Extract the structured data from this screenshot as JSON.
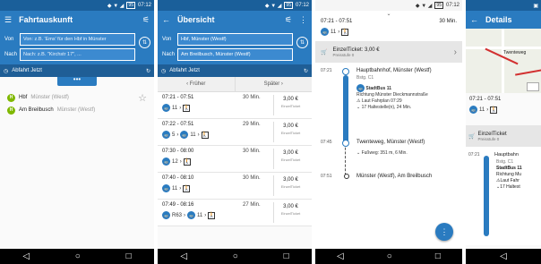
{
  "status": {
    "time": "07:12",
    "battery": "95"
  },
  "search": {
    "title": "Fahrtauskunft",
    "from_label": "Von",
    "from_placeholder": "Von: z.B. 'Ems' für den Hbf in Münster",
    "to_label": "Nach",
    "to_placeholder": "Nach: z.B. \"Kirchstr 17\", ...",
    "departure": "Abfahrt Jetzt",
    "more": "•••",
    "favorites": [
      {
        "name": "Hbf",
        "sub": "Münster (Westf)"
      },
      {
        "name": "Am Breilbusch",
        "sub": "Münster (Westf)"
      }
    ]
  },
  "overview": {
    "title": "Übersicht",
    "from_label": "Von",
    "from_value": "Hbf, Münster (Westf)",
    "to_label": "Nach",
    "to_value": "Am Breilbusch, Münster (Westf)",
    "departure": "Abfahrt Jetzt",
    "earlier": "Früher",
    "later": "Später",
    "ticket_label": "EinzelTicket",
    "connections": [
      {
        "time": "07:21 - 07:51",
        "dur": "30 Min.",
        "price": "3,00 €",
        "legs": [
          "11",
          "walk"
        ]
      },
      {
        "time": "07:22 - 07:51",
        "dur": "29 Min.",
        "price": "3,00 €",
        "legs": [
          "5",
          "11",
          "walk"
        ]
      },
      {
        "time": "07:30 - 08:00",
        "dur": "30 Min.",
        "price": "3,00 €",
        "legs": [
          "12",
          "walk"
        ]
      },
      {
        "time": "07:40 - 08:10",
        "dur": "30 Min.",
        "price": "3,00 €",
        "legs": [
          "11",
          "walk"
        ]
      },
      {
        "time": "07:49 - 08:16",
        "dur": "27 Min.",
        "price": "3,00 €",
        "legs": [
          "R63",
          "11",
          "walk"
        ]
      }
    ]
  },
  "detail": {
    "time_range": "07:21 - 07:51",
    "duration": "30 Min.",
    "leg_line": "11",
    "ticket": "EinzelTicket: 3,00 €",
    "ticket_sub": "Preisstufe 0",
    "stop1_time": "07:21",
    "stop1_name": "Hauptbahnhof, Münster (Westf)",
    "stop1_sub": "Bstg. C1",
    "line_name": "StadtBus 11",
    "direction": "Richtung Münster Dieckmannstraße",
    "schedule": "Laut Fahrplan 07:29",
    "halts": "17 Haltestelle(n), 24 Min.",
    "stop2_time": "07:45",
    "stop2_name": "Twenteweg, Münster (Westf)",
    "walk": "Fußweg: 351 m, 6 Min.",
    "stop3_time": "07:51",
    "stop3_name": "Münster (Westf), Am Breilbusch"
  },
  "details_screen": {
    "title": "Details",
    "map_label": "Twenteweg",
    "time_range": "07:21 - 07:51",
    "leg_line": "11",
    "ticket": "EinzelTicket",
    "ticket_sub": "Preisstufe 0",
    "stop1_time": "07:21",
    "stop1_name": "Hauptbahn",
    "stop1_sub": "Bstg. C1",
    "line_name": "StadtBus 11",
    "direction": "Richtung Mu",
    "schedule": "Laut Fahr",
    "halts": "17 Haltest"
  }
}
